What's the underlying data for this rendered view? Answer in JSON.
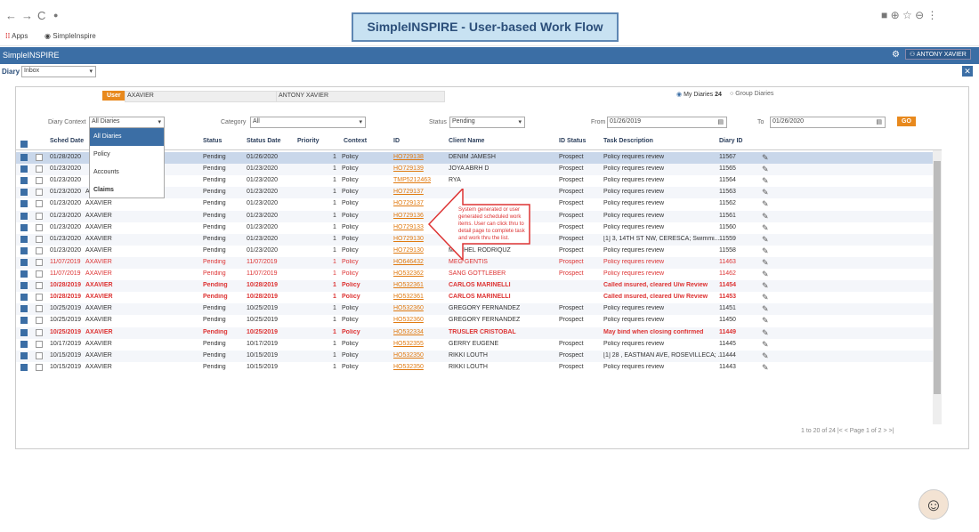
{
  "browser": {
    "back": "←",
    "fwd": "→",
    "reload": "C",
    "lock": "●",
    "apps": "Apps",
    "bookmark": "SimpleInspire",
    "icons": "■ ⊕ ☆ ⊖ ⋮"
  },
  "banner": "SimpleINSPIRE - User-based Work Flow",
  "appbar": {
    "title": "SimpleINSPIRE",
    "user": "ANTONY XAVIER"
  },
  "diary": {
    "label": "Diary",
    "value": "Inbox"
  },
  "top": {
    "user_btn": "User",
    "user_code": "AXAVIER",
    "user_name": "ANTONY XAVIER",
    "my": "My Diaries",
    "my_count": "24",
    "group": "Group Diaries"
  },
  "filters": {
    "ctx_label": "Diary Context",
    "ctx_value": "All Diaries",
    "cat_label": "Category",
    "cat_value": "All",
    "status_label": "Status",
    "status_value": "Pending",
    "from_label": "From",
    "from_value": "01/26/2019",
    "to_label": "To",
    "to_value": "01/26/2020",
    "go": "GO"
  },
  "dropdown": [
    "All Diaries",
    "Policy",
    "Accounts",
    "Claims"
  ],
  "columns": [
    "Sched Date",
    "Status",
    "Status Date",
    "Priority",
    "Context",
    "ID",
    "Client Name",
    "ID Status",
    "Task Description",
    "Diary ID"
  ],
  "rows": [
    [
      "01/28/2020",
      "",
      "Pending",
      "01/26/2020",
      "1",
      "Policy",
      "HO729138",
      "DENIM JAMESH",
      "Prospect",
      "Policy requires review",
      "11567",
      "n"
    ],
    [
      "01/23/2020",
      "",
      "Pending",
      "01/23/2020",
      "1",
      "Policy",
      "HO729139",
      "JOYA ABRH D",
      "Prospect",
      "Policy requires review",
      "11565",
      "n"
    ],
    [
      "01/23/2020",
      "",
      "Pending",
      "01/23/2020",
      "1",
      "Policy",
      "TMP5212463",
      "RYA",
      "Prospect",
      "Policy requires review",
      "11564",
      "n"
    ],
    [
      "01/23/2020",
      "AXAVIER",
      "Pending",
      "01/23/2020",
      "1",
      "Policy",
      "HO729137",
      "",
      "Prospect",
      "Policy requires review",
      "11563",
      "n"
    ],
    [
      "01/23/2020",
      "AXAVIER",
      "Pending",
      "01/23/2020",
      "1",
      "Policy",
      "HO729137",
      "",
      "Prospect",
      "Policy requires review",
      "11562",
      "n"
    ],
    [
      "01/23/2020",
      "AXAVIER",
      "Pending",
      "01/23/2020",
      "1",
      "Policy",
      "HO729136",
      "",
      "Prospect",
      "Policy requires review",
      "11561",
      "n"
    ],
    [
      "01/23/2020",
      "AXAVIER",
      "Pending",
      "01/23/2020",
      "1",
      "Policy",
      "HO729133",
      "DE AN",
      "Prospect",
      "Policy requires review",
      "11560",
      "n"
    ],
    [
      "01/23/2020",
      "AXAVIER",
      "Pending",
      "01/23/2020",
      "1",
      "Policy",
      "HO729130",
      "MITCHEL RIQUZ",
      "Prospect",
      "[1] 3, 14TH ST NW, CERESCA; Swimmi...",
      "11559",
      "n"
    ],
    [
      "01/23/2020",
      "AXAVIER",
      "Pending",
      "01/23/2020",
      "1",
      "Policy",
      "HO729130",
      "MITCHEL RODRIQUZ",
      "Prospect",
      "Policy requires review",
      "11558",
      "n"
    ],
    [
      "11/07/2019",
      "AXAVIER",
      "Pending",
      "11/07/2019",
      "1",
      "Policy",
      "HO646432",
      "MEG GENTIS",
      "Prospect",
      "Policy requires review",
      "11463",
      "r"
    ],
    [
      "11/07/2019",
      "AXAVIER",
      "Pending",
      "11/07/2019",
      "1",
      "Policy",
      "HO532362",
      "SANG GOTTLEBER",
      "Prospect",
      "Policy requires review",
      "11462",
      "r"
    ],
    [
      "10/28/2019",
      "AXAVIER",
      "Pending",
      "10/28/2019",
      "1",
      "Policy",
      "HO532361",
      "CARLOS MARINELLI",
      "",
      "Called insured, cleared U/w Review",
      "11454",
      "rb"
    ],
    [
      "10/28/2019",
      "AXAVIER",
      "Pending",
      "10/28/2019",
      "1",
      "Policy",
      "HO532361",
      "CARLOS MARINELLI",
      "",
      "Called insured, cleared U/w Review",
      "11453",
      "rb"
    ],
    [
      "10/25/2019",
      "AXAVIER",
      "Pending",
      "10/25/2019",
      "1",
      "Policy",
      "HO532360",
      "GREGORY FERNANDEZ",
      "Prospect",
      "Policy requires review",
      "11451",
      "n"
    ],
    [
      "10/25/2019",
      "AXAVIER",
      "Pending",
      "10/25/2019",
      "1",
      "Policy",
      "HO532360",
      "GREGORY FERNANDEZ",
      "Prospect",
      "Policy requires review",
      "11450",
      "n"
    ],
    [
      "10/25/2019",
      "AXAVIER",
      "Pending",
      "10/25/2019",
      "1",
      "Policy",
      "HO532334",
      "TRUSLER CRISTOBAL",
      "",
      "May bind when closing confirmed",
      "11449",
      "rb"
    ],
    [
      "10/17/2019",
      "AXAVIER",
      "Pending",
      "10/17/2019",
      "1",
      "Policy",
      "HO532355",
      "GERRY EUGENE",
      "Prospect",
      "Policy requires review",
      "11445",
      "n"
    ],
    [
      "10/15/2019",
      "AXAVIER",
      "Pending",
      "10/15/2019",
      "1",
      "Policy",
      "HO532350",
      "RIKKI LOUTH",
      "Prospect",
      "[1] 28 , EASTMAN AVE, ROSEVILLECA; ...",
      "11444",
      "n"
    ],
    [
      "10/15/2019",
      "AXAVIER",
      "Pending",
      "10/15/2019",
      "1",
      "Policy",
      "HO532350",
      "RIKKI LOUTH",
      "Prospect",
      "Policy requires review",
      "11443",
      "n"
    ]
  ],
  "callout": "System generated or user generated scheduled work items. User can click thru to detail page to complete task and work thru the list.",
  "pager": "1 to 20 of 24   |< < Page 1 of 2 > >|",
  "colors": {
    "header": "#3b6ea5",
    "accent": "#e8891d",
    "alert": "#d33"
  }
}
